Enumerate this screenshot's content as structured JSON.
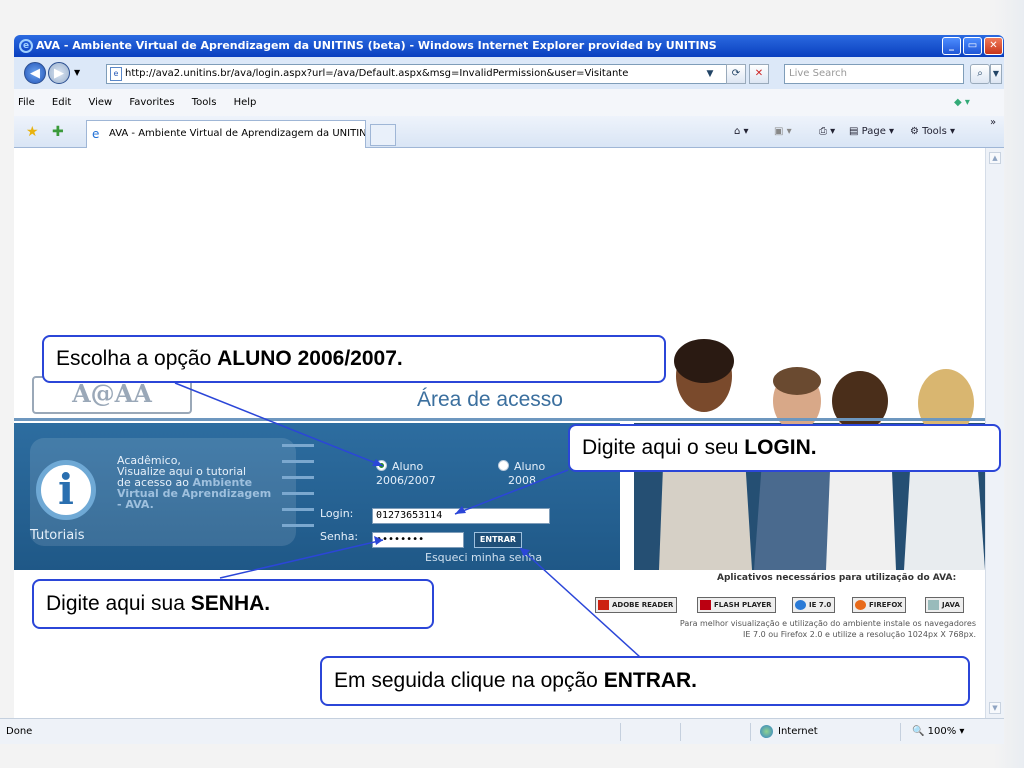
{
  "window": {
    "title": "AVA - Ambiente Virtual de Aprendizagem da UNITINS (beta) - Windows Internet Explorer provided by UNITINS",
    "buttons": {
      "minimize": "_",
      "maximize": "▭",
      "close": "✕"
    }
  },
  "address": {
    "url": "http://ava2.unitins.br/ava/login.aspx?url=/ava/Default.aspx&msg=InvalidPermission&user=Visitante",
    "search_placeholder": "Live Search"
  },
  "menu": {
    "items": [
      "File",
      "Edit",
      "View",
      "Favorites",
      "Tools",
      "Help"
    ]
  },
  "tabs": {
    "active_label": "AVA - Ambiente Virtual de Aprendizagem da UNITINS ...",
    "page_label": "Page",
    "tools_label": "Tools"
  },
  "page": {
    "logo": "A@AA",
    "area_title": "Área de acesso",
    "tutorial": {
      "line1": "Acadêmico,",
      "line2": "Visualize aqui o tutorial",
      "line3": "de acesso ao ",
      "line3_bold": "Ambiente",
      "line4": "Virtual de Aprendizagem",
      "line5": "- AVA.",
      "label": "Tutoriais"
    },
    "radio1": {
      "line1": "Aluno",
      "line2": "2006/2007",
      "checked": true
    },
    "radio2": {
      "line1": "Aluno",
      "line2": "2008",
      "checked": false
    },
    "login_label": "Login:",
    "login_value": "01273653114",
    "senha_label": "Senha:",
    "senha_value": "••••••••",
    "entrar": "ENTRAR",
    "forgot": "Esqueci minha senha",
    "apps_title": "Aplicativos necessários para utilização do AVA:",
    "apps": [
      "ADOBE READER",
      "FLASH PLAYER",
      "IE 7.0",
      "FIREFOX",
      "JAVA"
    ],
    "apps_note_1": "Para melhor visualização e utilização do ambiente instale os navegadores",
    "apps_note_2": "IE 7.0 ou Firefox 2.0 e utilize a resolução 1024px X 768px."
  },
  "status": {
    "left": "Done",
    "zone": "Internet",
    "zoom": "100%"
  },
  "callouts": {
    "aluno": {
      "text": "Escolha a opção ",
      "bold": "ALUNO 2006/2007."
    },
    "login": {
      "text": "Digite aqui o seu ",
      "bold": "LOGIN."
    },
    "senha": {
      "text": "Digite aqui sua ",
      "bold": "SENHA."
    },
    "entrar": {
      "text": "Em seguida clique na opção ",
      "bold": "ENTRAR."
    }
  },
  "colors": {
    "callout_border": "#2b46d8",
    "band": "#2d6da0",
    "title_bar": "#0a3fbf"
  }
}
